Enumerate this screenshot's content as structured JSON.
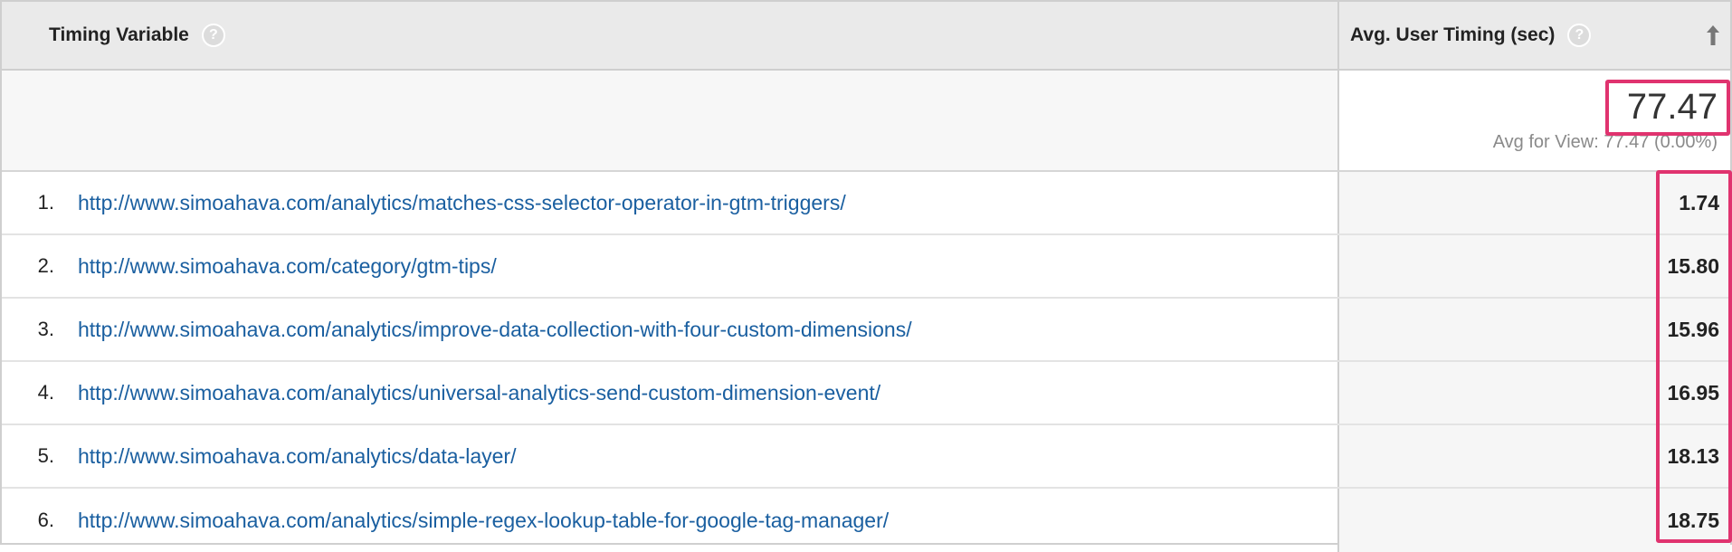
{
  "header": {
    "dimension_label": "Timing Variable",
    "metric_label": "Avg. User Timing (sec)",
    "help_glyph": "?"
  },
  "summary": {
    "value": "77.47",
    "sub": "Avg for View: 77.47 (0.00%)"
  },
  "rows": [
    {
      "num": "1.",
      "url": "http://www.simoahava.com/analytics/matches-css-selector-operator-in-gtm-triggers/",
      "value": "1.74"
    },
    {
      "num": "2.",
      "url": "http://www.simoahava.com/category/gtm-tips/",
      "value": "15.80"
    },
    {
      "num": "3.",
      "url": "http://www.simoahava.com/analytics/improve-data-collection-with-four-custom-dimensions/",
      "value": "15.96"
    },
    {
      "num": "4.",
      "url": "http://www.simoahava.com/analytics/universal-analytics-send-custom-dimension-event/",
      "value": "16.95"
    },
    {
      "num": "5.",
      "url": "http://www.simoahava.com/analytics/data-layer/",
      "value": "18.13"
    },
    {
      "num": "6.",
      "url": "http://www.simoahava.com/analytics/simple-regex-lookup-table-for-google-tag-manager/",
      "value": "18.75"
    }
  ],
  "colors": {
    "link": "#1a5fa0",
    "highlight": "#e0336f",
    "header_bg": "#eaeaea"
  },
  "icons": {
    "help": "help-circle-icon",
    "sort": "arrow-up-icon"
  }
}
